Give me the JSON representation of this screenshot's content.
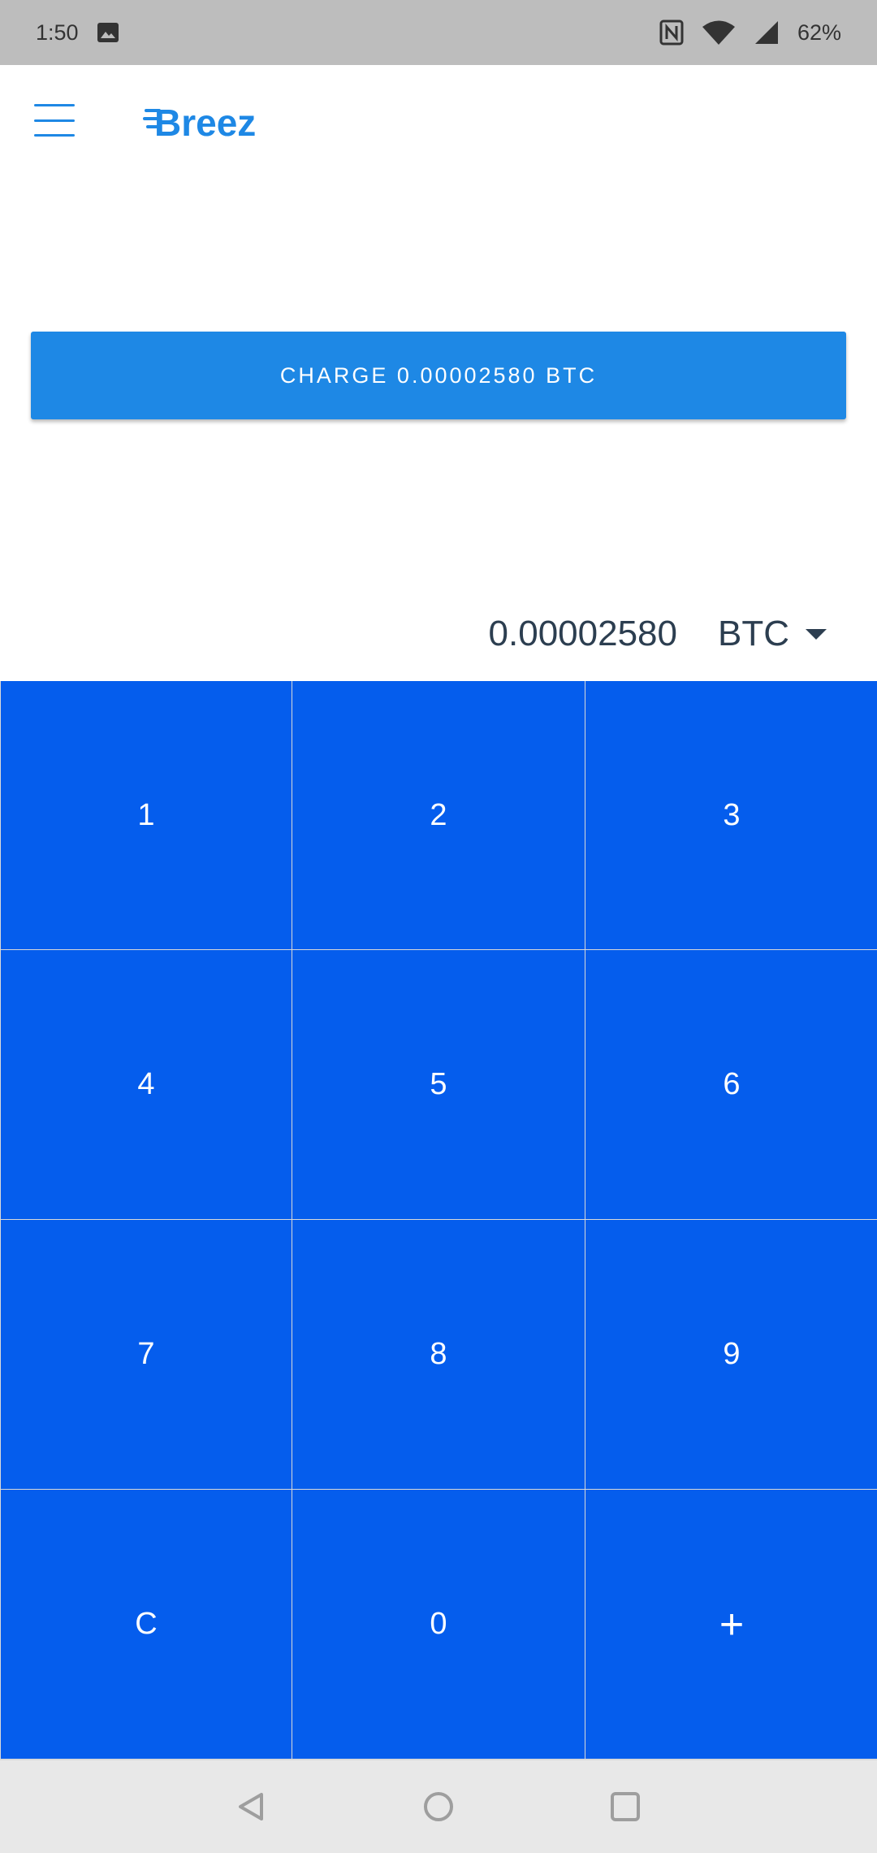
{
  "status_bar": {
    "time": "1:50",
    "battery": "62%",
    "icons": [
      "image-icon",
      "nfc-icon",
      "wifi-icon",
      "signal-icon"
    ]
  },
  "app_bar": {
    "menu_icon": "hamburger-menu-icon",
    "logo_text": "Breez",
    "logo_color": "#1e88e5"
  },
  "charge_button": {
    "label": "CHARGE 0.00002580 BTC",
    "color": "#1e88e5"
  },
  "amount": {
    "value": "0.00002580",
    "currency": "BTC"
  },
  "keypad": {
    "color": "#055ded",
    "keys": [
      "1",
      "2",
      "3",
      "4",
      "5",
      "6",
      "7",
      "8",
      "9",
      "C",
      "0",
      "+"
    ]
  },
  "nav_bar": {
    "icons": [
      "back-icon",
      "home-icon",
      "recents-icon"
    ]
  }
}
